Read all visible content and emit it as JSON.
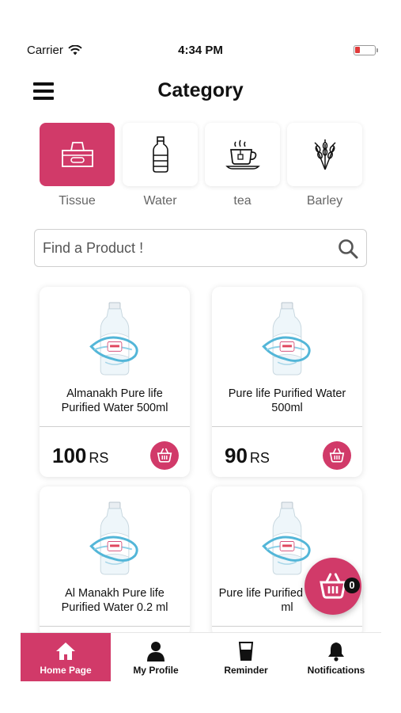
{
  "status_bar": {
    "carrier": "Carrier",
    "time": "4:34 PM"
  },
  "header": {
    "title": "Category"
  },
  "categories": [
    {
      "label": "Tissue",
      "icon": "tissue-box-icon",
      "active": true
    },
    {
      "label": "Water",
      "icon": "water-bottle-icon",
      "active": false
    },
    {
      "label": "tea",
      "icon": "tea-cup-icon",
      "active": false
    },
    {
      "label": "Barley",
      "icon": "barley-icon",
      "active": false
    }
  ],
  "search": {
    "placeholder": "Find a Product !"
  },
  "products": [
    {
      "name": "Almanakh Pure life Purified Water 500ml",
      "price": "100",
      "currency": "RS"
    },
    {
      "name": "Pure life Purified Water 500ml",
      "price": "90",
      "currency": "RS"
    },
    {
      "name": "Al Manakh Pure life Purified Water 0.2 ml",
      "price": "",
      "currency": ""
    },
    {
      "name": "Pure life Purified Water 0.2 ml",
      "price": "",
      "currency": ""
    }
  ],
  "cart": {
    "count": "0"
  },
  "bottom_nav": [
    {
      "label": "Home Page",
      "icon": "home-icon",
      "active": true
    },
    {
      "label": "My Profile",
      "icon": "profile-icon",
      "active": false
    },
    {
      "label": "Reminder",
      "icon": "glass-icon",
      "active": false
    },
    {
      "label": "Notifications",
      "icon": "bell-icon",
      "active": false
    }
  ],
  "colors": {
    "accent": "#d13a69",
    "text": "#111111",
    "muted": "#666666"
  }
}
